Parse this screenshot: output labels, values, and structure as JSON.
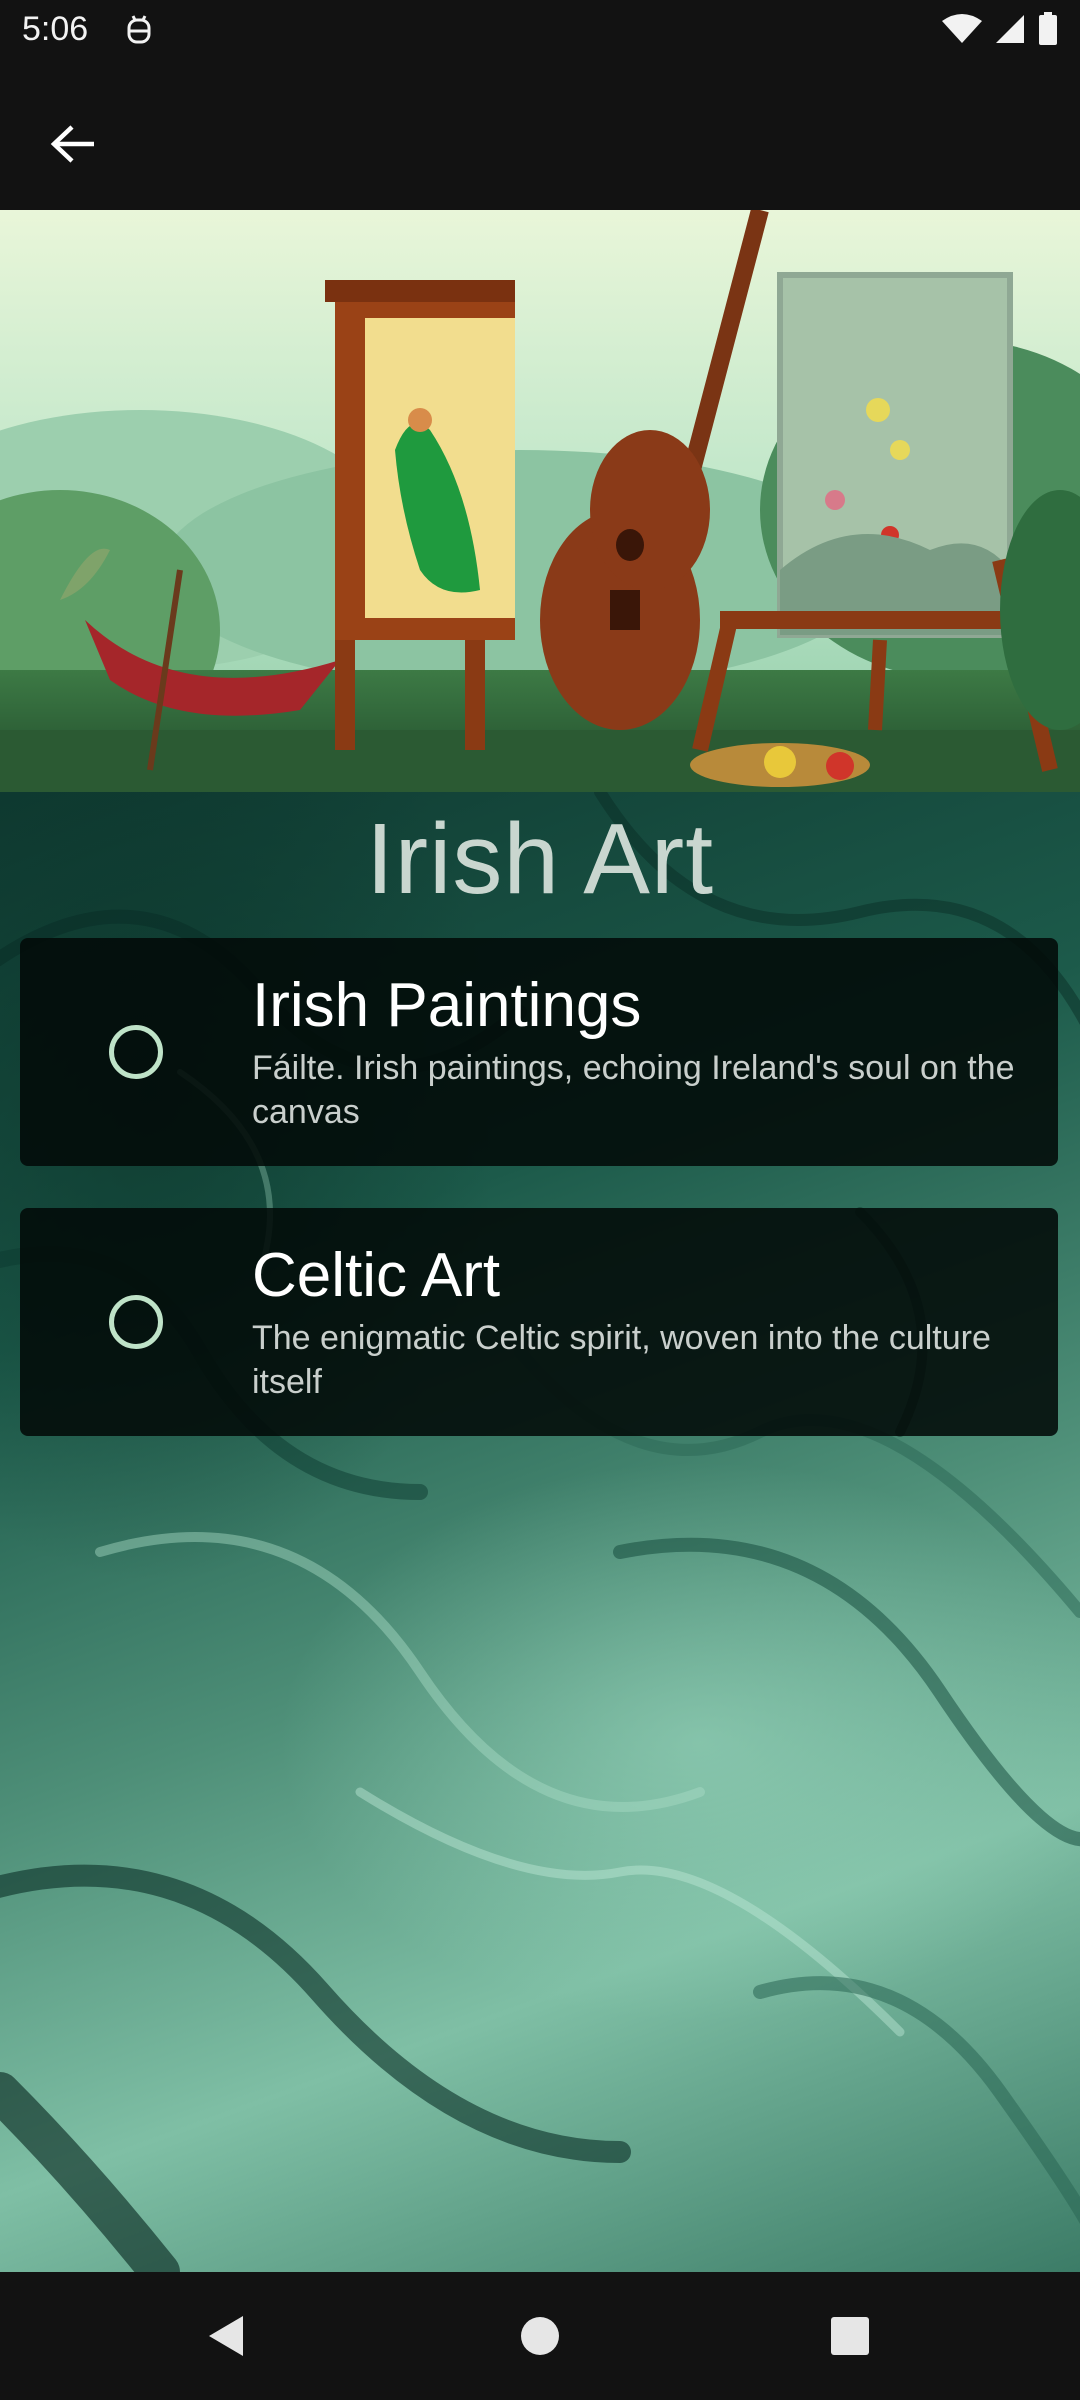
{
  "status_bar": {
    "time": "5:06",
    "left_icon": "android-debug-icon",
    "right_icons": [
      "wifi-icon",
      "signal-icon",
      "battery-icon"
    ]
  },
  "app_bar": {
    "back_icon": "arrow-back-icon"
  },
  "hero": {
    "image": "irish-art-easel-guitar-illustration"
  },
  "page": {
    "title": "Irish Art"
  },
  "options": [
    {
      "title": "Irish Paintings",
      "description": "Fáilte. Irish paintings, echoing Ireland's soul on the canvas",
      "selected": false
    },
    {
      "title": "Celtic Art",
      "description": "The enigmatic Celtic spirit, woven into the culture itself",
      "selected": false
    }
  ],
  "nav_bar": {
    "back_icon": "nav-back-icon",
    "home_icon": "nav-home-icon",
    "recents_icon": "nav-recents-icon"
  },
  "colors": {
    "radio_ring": "#bfe3c8",
    "background_dark": "#121212",
    "card": "#020a08"
  }
}
